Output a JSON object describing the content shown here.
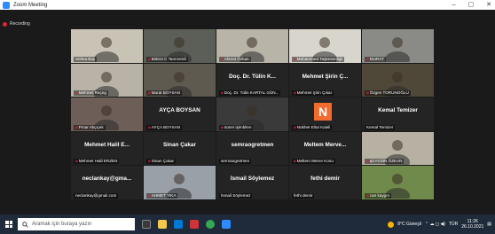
{
  "window": {
    "title": "Zoom Meeting",
    "controls": [
      "–",
      "▢",
      "✕"
    ]
  },
  "recording": {
    "label": "Recording"
  },
  "participants": [
    {
      "name": "Selma Baş",
      "display": "",
      "video": true,
      "muted": false,
      "active": true,
      "tone": "#c9c3b5"
    },
    {
      "name": "Bülent C Tanrıverdi",
      "display": "",
      "video": true,
      "muted": true,
      "tone": "#5c5f58"
    },
    {
      "name": "Ahmet Özkan",
      "display": "",
      "video": true,
      "muted": true,
      "tone": "#b9b4a8"
    },
    {
      "name": "Muhammed Taşkesenligil",
      "display": "",
      "video": true,
      "muted": true,
      "tone": "#d8d5cd"
    },
    {
      "name": "MURAT",
      "display": "",
      "video": true,
      "muted": true,
      "tone": "#8a8a86"
    },
    {
      "name": "Mehmet Reçeg",
      "display": "",
      "video": true,
      "muted": true,
      "tone": "#b8b3a6"
    },
    {
      "name": "Murat BOYSAN",
      "display": "",
      "video": true,
      "muted": true,
      "tone": "#5f5a50"
    },
    {
      "name": "Doç. Dr. Tülin KARTAL GÜN...",
      "display": "Doç. Dr. Tülin K...",
      "video": false,
      "muted": true
    },
    {
      "name": "Mehmet Şirin Çıkar",
      "display": "Mehmet Şirin Ç...",
      "video": false,
      "muted": true
    },
    {
      "name": "Özgen TORUNOĞLU",
      "display": "",
      "video": true,
      "muted": true,
      "tone": "#4f4838"
    },
    {
      "name": "Pınar Akçiçek",
      "display": "",
      "video": true,
      "muted": true,
      "tone": "#6e5e58"
    },
    {
      "name": "AYÇA BOYSAN",
      "display": "AYÇA BOYSAN",
      "video": false,
      "muted": true
    },
    {
      "name": "soner işimbilen",
      "display": "",
      "video": true,
      "muted": true,
      "tone": "#3a3a3a"
    },
    {
      "name": "Nükhet Eltut Kaleli",
      "display": "",
      "video": false,
      "muted": true,
      "avatar": "N"
    },
    {
      "name": "Kemal Temizer",
      "display": "Kemal Temizer",
      "video": false,
      "muted": false
    },
    {
      "name": "Mehmet Halil ERZEN",
      "display": "Mehmet Halil E...",
      "video": false,
      "muted": true
    },
    {
      "name": "Sinan Çakar",
      "display": "Sinan Çakar",
      "video": false,
      "muted": true
    },
    {
      "name": "semraogretmen",
      "display": "semraogretmen",
      "video": false,
      "muted": false
    },
    {
      "name": "Meltem Merve Konu",
      "display": "Meltem Merve...",
      "video": false,
      "muted": true
    },
    {
      "name": "Ipl AYDIN ÖZKAN",
      "display": "",
      "video": true,
      "muted": true,
      "tone": "#b7b1a3"
    },
    {
      "name": "neclankay@gmail.com",
      "display": "neclankay@gma...",
      "video": false,
      "muted": false
    },
    {
      "name": "AHMET YİKA",
      "display": "",
      "video": true,
      "muted": true,
      "tone": "#9aa0a8"
    },
    {
      "name": "İsmail Söylemez",
      "display": "İsmail Söylemez",
      "video": false,
      "muted": false
    },
    {
      "name": "fethi demir",
      "display": "fethi demir",
      "video": false,
      "muted": false
    },
    {
      "name": "can kaygın",
      "display": "",
      "video": true,
      "muted": true,
      "tone": "#6f8a4a"
    }
  ],
  "taskbar": {
    "search_placeholder": "Aramak için buraya yazın",
    "weather": "8°C Güneşli",
    "language": "TÜR",
    "time": "11:26",
    "date": "26.10.2021"
  }
}
